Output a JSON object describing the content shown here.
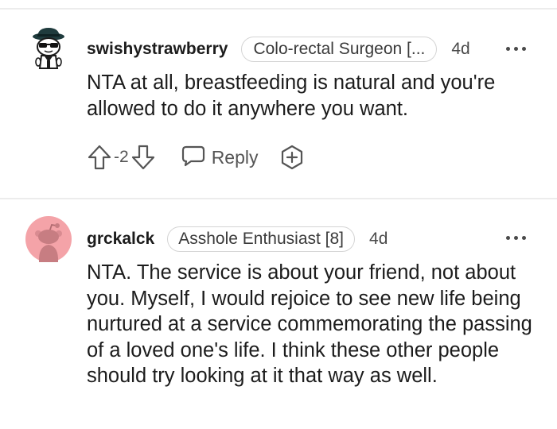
{
  "comments": [
    {
      "username": "swishystrawberry",
      "flair": "Colo-rectal Surgeon [...",
      "age": "4d",
      "body": "NTA at all, breastfeeding is natural and you're allowed to do it anywhere you want.",
      "score": "-2",
      "reply_label": "Reply",
      "icons": [
        "snoo-avatar-icon",
        "upvote-icon",
        "downvote-icon",
        "reply-bubble-icon",
        "award-plus-icon",
        "more-options-icon"
      ]
    },
    {
      "username": "grckalck",
      "flair": "Asshole Enthusiast [8]",
      "age": "4d",
      "body": "NTA. The service is about your friend, not about you. Myself, I would rejoice to see new life being nurtured at a service commemorating the passing of a loved one's life. I think these other people should try looking at it that way as well.",
      "icons": [
        "snoo-avatar-icon",
        "more-options-icon"
      ]
    }
  ],
  "colors": {
    "text": "#1c1c1c",
    "meta": "#4a4a4a",
    "divider": "#ececec",
    "avatar_pink": "#f4a3a8",
    "flair_border": "#d4d4d4"
  }
}
